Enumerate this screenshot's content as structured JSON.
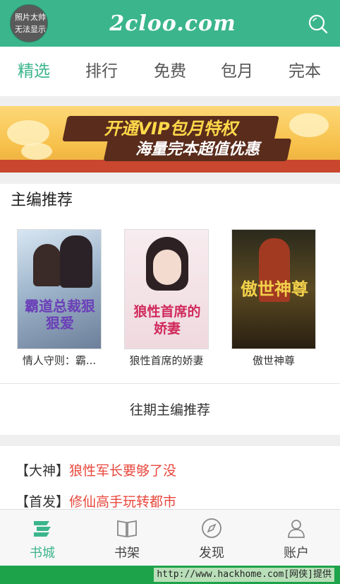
{
  "header": {
    "avatar_line1": "照片太帅",
    "avatar_line2": "无法显示",
    "logo": "2cloo.com",
    "search_icon": "search-icon",
    "brand_color": "#3bb58c"
  },
  "tabs": [
    {
      "label": "精选",
      "active": true
    },
    {
      "label": "排行",
      "active": false
    },
    {
      "label": "免费",
      "active": false
    },
    {
      "label": "包月",
      "active": false
    },
    {
      "label": "完本",
      "active": false
    }
  ],
  "banner": {
    "line1": "开通VIP包月特权",
    "line2": "海量完本超值优惠"
  },
  "editor_picks": {
    "title": "主编推荐",
    "books": [
      {
        "title": "情人守则：霸...",
        "cover_text": "霸道总裁狠狠爱"
      },
      {
        "title": "狼性首席的娇妻",
        "cover_text": "狼性首席的娇妻"
      },
      {
        "title": "傲世神尊",
        "cover_text": "傲世神尊"
      }
    ],
    "past_link": "往期主编推荐"
  },
  "list": [
    {
      "tag": "【大神】",
      "text": "狼性军长要够了没"
    },
    {
      "tag": "【首发】",
      "text": "修仙高手玩转都市"
    }
  ],
  "bottom_nav": [
    {
      "label": "书城",
      "icon": "bookstore-icon",
      "active": true
    },
    {
      "label": "书架",
      "icon": "bookshelf-icon",
      "active": false
    },
    {
      "label": "发现",
      "icon": "compass-icon",
      "active": false
    },
    {
      "label": "账户",
      "icon": "user-icon",
      "active": false
    }
  ],
  "watermark": "http://www.hackhome.com[网侠]提供"
}
